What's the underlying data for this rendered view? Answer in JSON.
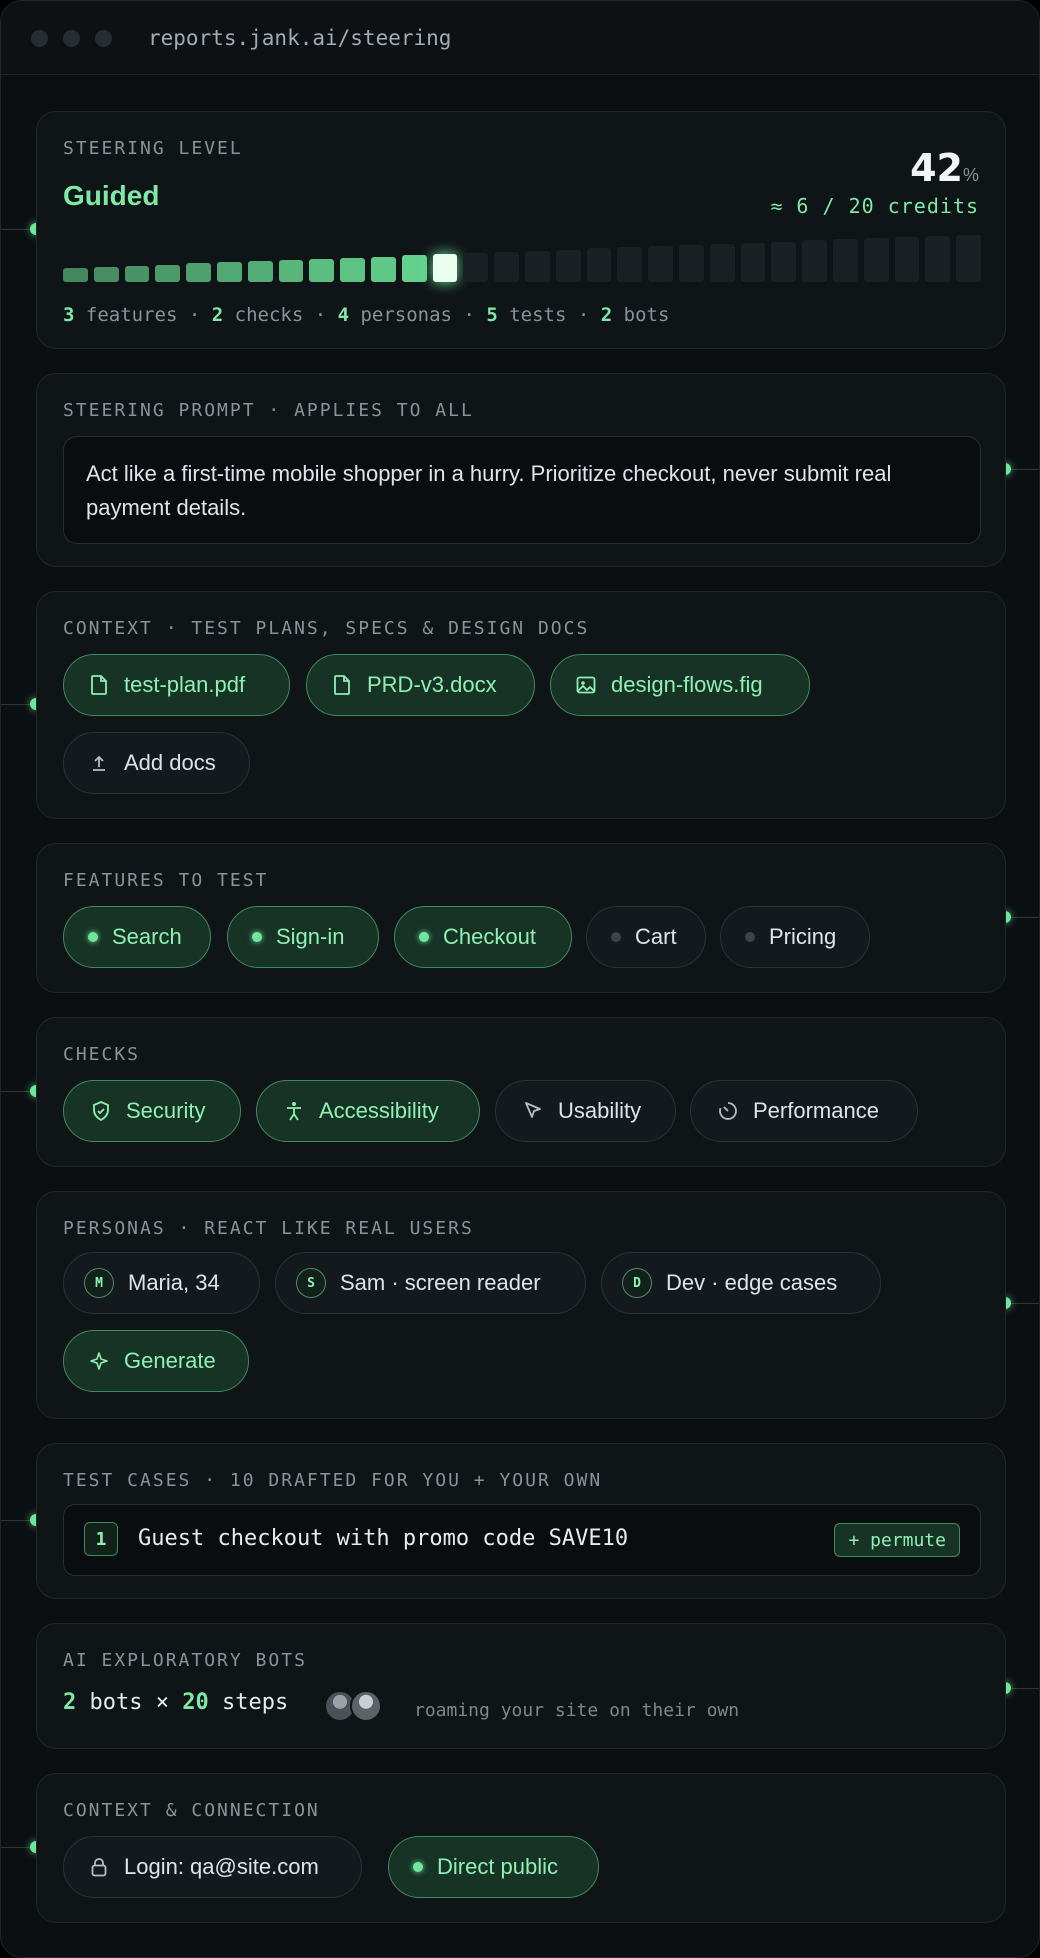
{
  "browser": {
    "url": "reports.jank.ai/steering"
  },
  "steering_level": {
    "label": "STEERING LEVEL",
    "level_name": "Guided",
    "percent": 42,
    "percent_symbol": "%",
    "credits_text": "≈ 6 / 20 credits",
    "bars_total": 30,
    "bars_filled": 13,
    "summary": [
      {
        "count": "3",
        "label": "features"
      },
      {
        "count": "2",
        "label": "checks"
      },
      {
        "count": "4",
        "label": "personas"
      },
      {
        "count": "5",
        "label": "tests"
      },
      {
        "count": "2",
        "label": "bots"
      }
    ],
    "separator": "·"
  },
  "steering_prompt": {
    "label": "STEERING PROMPT · APPLIES TO ALL",
    "text": "Act like a first-time mobile shopper in a hurry. Prioritize checkout, never submit real payment details."
  },
  "context_docs": {
    "label": "CONTEXT · TEST PLANS, SPECS & DESIGN DOCS",
    "docs": [
      {
        "name": "test-plan.pdf",
        "icon": "file-icon"
      },
      {
        "name": "PRD-v3.docx",
        "icon": "file-icon"
      },
      {
        "name": "design-flows.fig",
        "icon": "image-icon"
      }
    ],
    "add_label": "Add docs"
  },
  "features": {
    "label": "FEATURES TO TEST",
    "items": [
      {
        "name": "Search",
        "selected": true
      },
      {
        "name": "Sign-in",
        "selected": true
      },
      {
        "name": "Checkout",
        "selected": true
      },
      {
        "name": "Cart",
        "selected": false
      },
      {
        "name": "Pricing",
        "selected": false
      }
    ]
  },
  "checks": {
    "label": "CHECKS",
    "items": [
      {
        "name": "Security",
        "selected": true,
        "icon": "shield-icon"
      },
      {
        "name": "Accessibility",
        "selected": true,
        "icon": "accessibility-icon"
      },
      {
        "name": "Usability",
        "selected": false,
        "icon": "cursor-icon"
      },
      {
        "name": "Performance",
        "selected": false,
        "icon": "gauge-icon"
      }
    ]
  },
  "personas": {
    "label": "PERSONAS · REACT LIKE REAL USERS",
    "items": [
      {
        "initial": "M",
        "name": "Maria, 34"
      },
      {
        "initial": "S",
        "name": "Sam · screen reader"
      },
      {
        "initial": "D",
        "name": "Dev · edge cases"
      }
    ],
    "generate_label": "Generate"
  },
  "test_cases": {
    "label": "TEST CASES · 10 DRAFTED FOR YOU + YOUR OWN",
    "items": [
      {
        "index": "1",
        "text": "Guest checkout with promo code SAVE10",
        "action": "+ permute"
      }
    ]
  },
  "bots": {
    "label": "AI EXPLORATORY BOTS",
    "count": "2",
    "bots_word": "bots",
    "times": "×",
    "steps": "20",
    "steps_word": "steps",
    "note": "roaming your site on their own"
  },
  "connection": {
    "label": "CONTEXT & CONNECTION",
    "login": "Login: qa@site.com",
    "mode": "Direct public"
  },
  "colors": {
    "accent": "#6ee79a",
    "background": "#0b0f12",
    "card": "#0f1417"
  }
}
